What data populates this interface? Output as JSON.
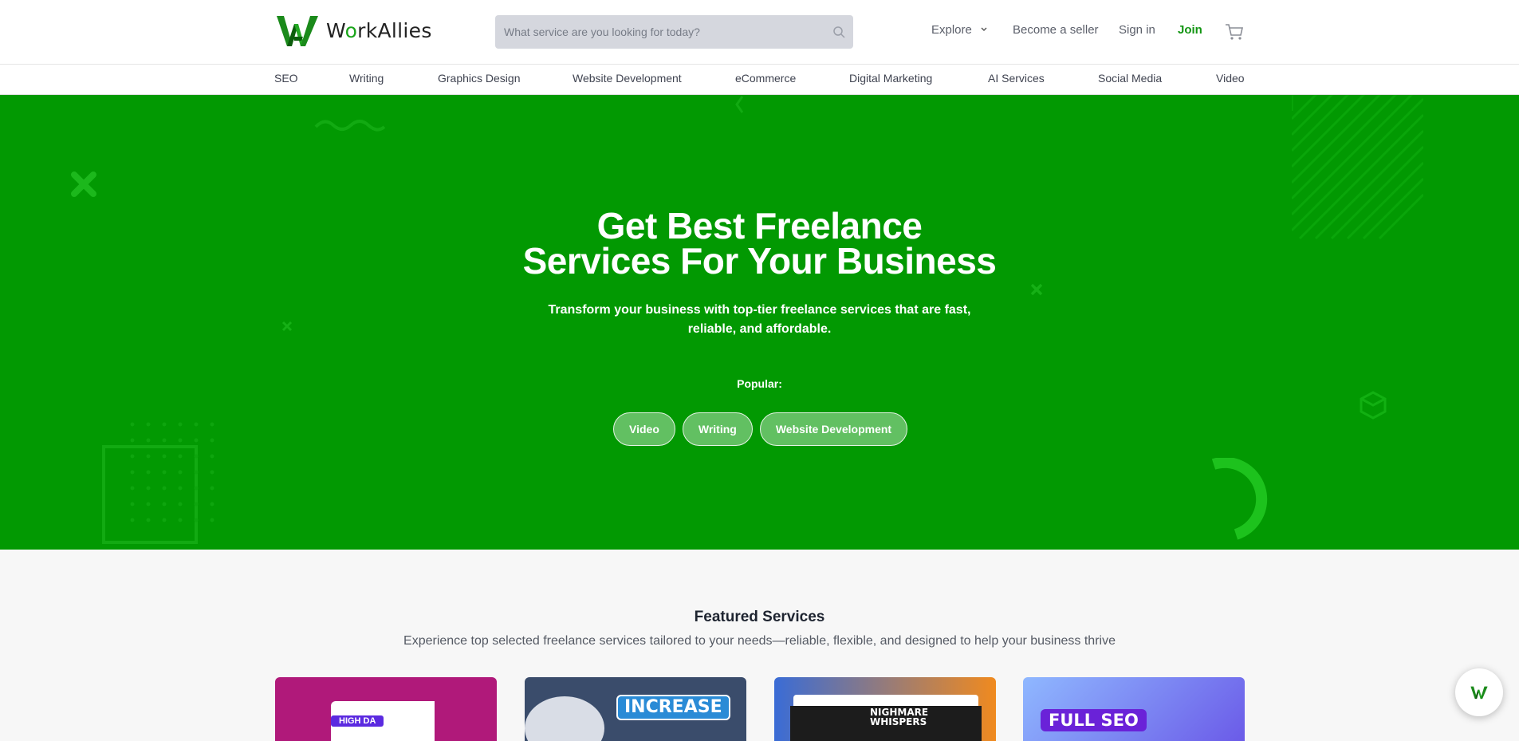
{
  "header": {
    "brand_name": "WorkAllies",
    "brand_prefix": "W",
    "brand_o": "o",
    "brand_suffix": "rkAllies",
    "search_placeholder": "What service are you looking for today?",
    "explore_label": "Explore",
    "become_seller_label": "Become a seller",
    "sign_in_label": "Sign in",
    "join_label": "Join",
    "icons": [
      "search-icon",
      "chevron-down-icon",
      "cart-icon"
    ],
    "accent_color": "#139513"
  },
  "categories": [
    "SEO",
    "Writing",
    "Graphics Design",
    "Website Development",
    "eCommerce",
    "Digital Marketing",
    "AI Services",
    "Social Media",
    "Video"
  ],
  "hero": {
    "title_line1": "Get Best Freelance",
    "title_line2": "Services For Your Business",
    "subtitle": "Transform your business with top-tier freelance services that are fast, reliable, and affordable.",
    "popular_label": "Popular:",
    "popular_chips": [
      "Video",
      "Writing",
      "Website Development"
    ],
    "background_color": "#029902"
  },
  "featured": {
    "title": "Featured Services",
    "description": "Experience top selected freelance services tailored to your needs—reliable, flexible, and designed to help your business thrive",
    "cards": [
      {
        "badge": "HIGH DA",
        "color": "#b0197a"
      },
      {
        "text": "INCREASE",
        "color": "#3a4c6b"
      },
      {
        "text": "NIGHMARE WHISPERS",
        "color": "#f08a1f"
      },
      {
        "text": "FULL SEO",
        "color": "#6b5be8"
      }
    ]
  },
  "chat": {
    "icon": "workallies-chat-icon"
  }
}
